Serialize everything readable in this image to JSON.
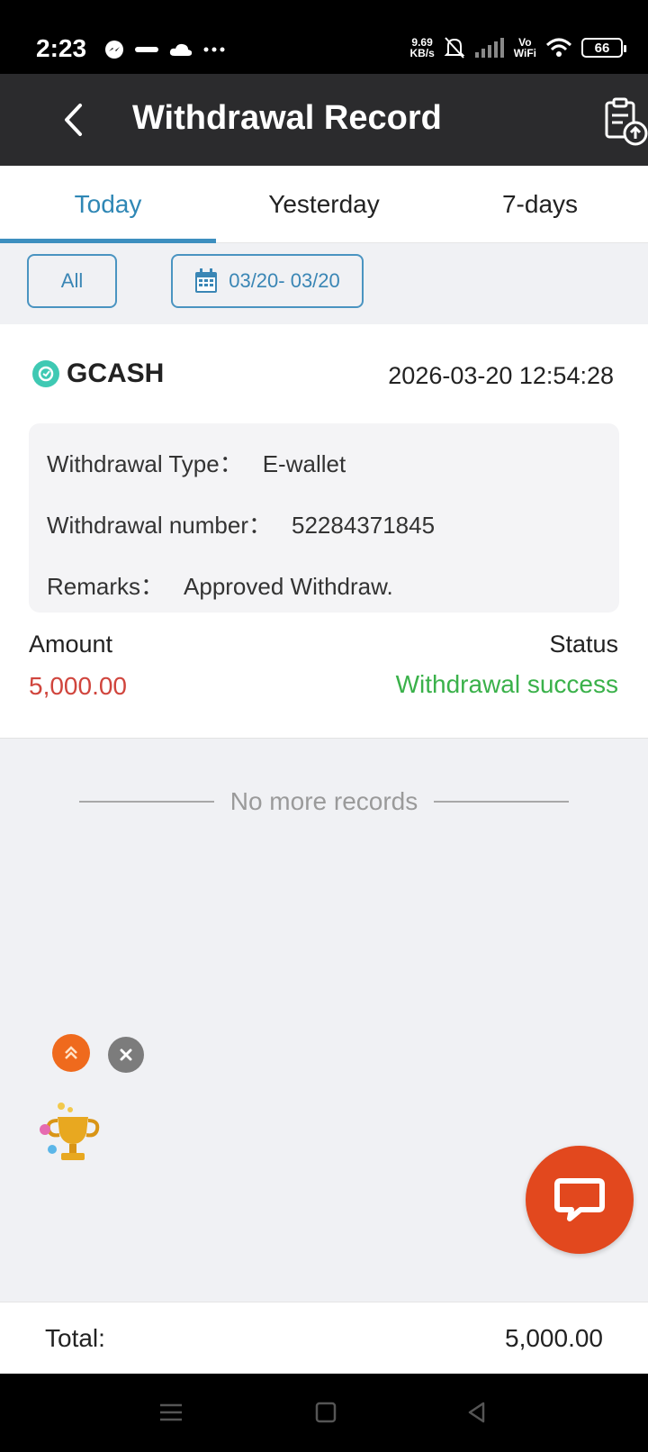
{
  "status_bar": {
    "time": "2:23",
    "speed_value": "9.69",
    "speed_unit": "KB/s",
    "vo_label": "Vo",
    "wifi_label": "WiFi",
    "battery": "66"
  },
  "header": {
    "title": "Withdrawal Record"
  },
  "tabs": [
    {
      "label": "Today",
      "active": true
    },
    {
      "label": "Yesterday",
      "active": false
    },
    {
      "label": "7-days",
      "active": false
    }
  ],
  "filters": {
    "type_label": "All",
    "date_range": "03/20- 03/20"
  },
  "record": {
    "provider": "GCASH",
    "datetime": "2026-03-20 12:54:28",
    "type_label": "Withdrawal Type：",
    "type_value": "E-wallet",
    "number_label": "Withdrawal number：",
    "number_value": "52284371845",
    "remarks_label": "Remarks：",
    "remarks_value": "Approved Withdraw.",
    "amount_label": "Amount",
    "amount_value": "5,000.00",
    "status_label": "Status",
    "status_value": "Withdrawal success"
  },
  "list_end_text": "No more records",
  "footer": {
    "total_label": "Total:",
    "total_value": "5,000.00"
  },
  "colors": {
    "accent": "#3d8fbf",
    "amount": "#d0453d",
    "success": "#3ab14a",
    "chat": "#e2481e"
  }
}
